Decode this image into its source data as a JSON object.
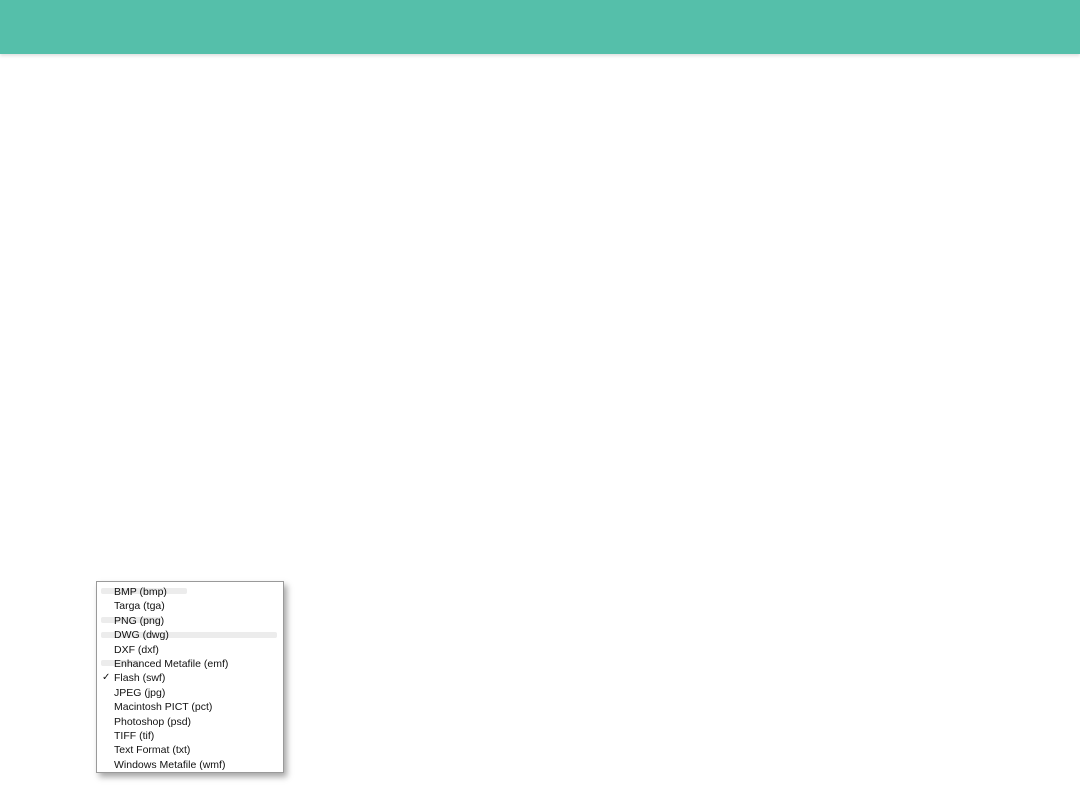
{
  "menu": {
    "items": [
      {
        "label": "BMP (bmp)",
        "checked": false
      },
      {
        "label": "Targa (tga)",
        "checked": false
      },
      {
        "label": "PNG (png)",
        "checked": false
      },
      {
        "label": "DWG (dwg)",
        "checked": false
      },
      {
        "label": "DXF (dxf)",
        "checked": false
      },
      {
        "label": "Enhanced Metafile (emf)",
        "checked": false
      },
      {
        "label": "Flash (swf)",
        "checked": true,
        "check_mark": "✓"
      },
      {
        "label": "JPEG (jpg)",
        "checked": false
      },
      {
        "label": "Macintosh PICT (pct)",
        "checked": false
      },
      {
        "label": "Photoshop (psd)",
        "checked": false
      },
      {
        "label": "TIFF (tif)",
        "checked": false
      },
      {
        "label": "Text Format (txt)",
        "checked": false
      },
      {
        "label": "Windows Metafile (wmf)",
        "checked": false
      }
    ]
  },
  "colors": {
    "header": "#55bfaa",
    "menu_border": "#9a9a9a"
  }
}
